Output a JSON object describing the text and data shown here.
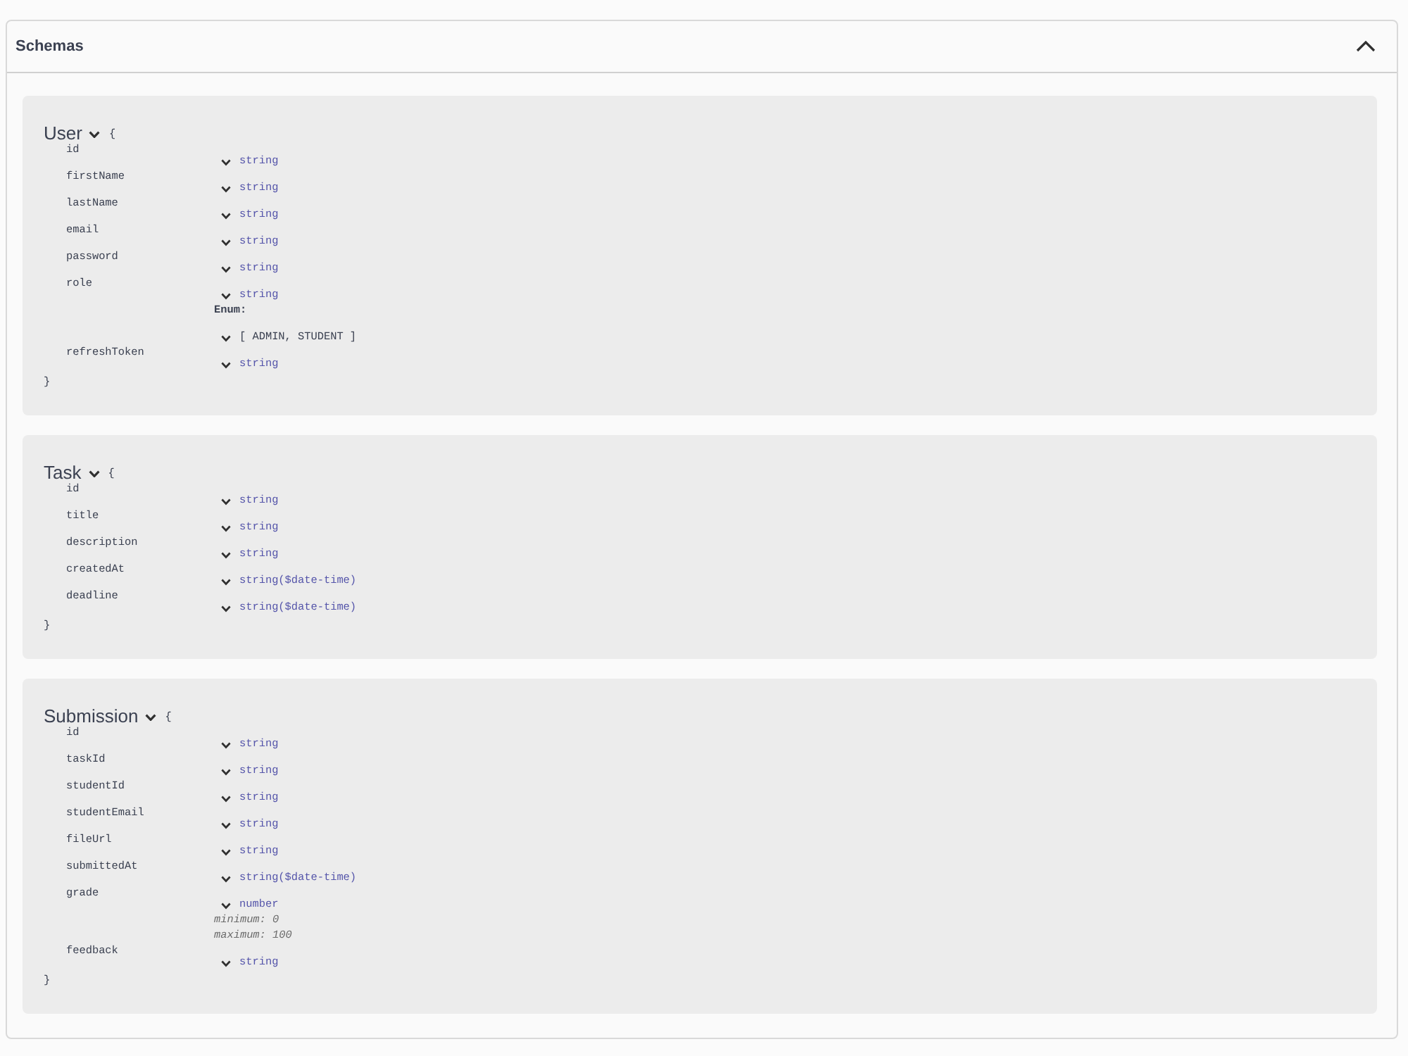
{
  "section": {
    "title": "Schemas",
    "expanded": true
  },
  "schemas": [
    {
      "name": "User",
      "expanded": true,
      "open_brace": "{",
      "close_brace": "}",
      "properties": [
        {
          "name": "id",
          "type": "string"
        },
        {
          "name": "firstName",
          "type": "string"
        },
        {
          "name": "lastName",
          "type": "string"
        },
        {
          "name": "email",
          "type": "string"
        },
        {
          "name": "password",
          "type": "string"
        },
        {
          "name": "role",
          "type": "string",
          "enum_label": "Enum:",
          "enum_values": "[ ADMIN, STUDENT ]"
        },
        {
          "name": "refreshToken",
          "type": "string"
        }
      ]
    },
    {
      "name": "Task",
      "expanded": true,
      "open_brace": "{",
      "close_brace": "}",
      "properties": [
        {
          "name": "id",
          "type": "string"
        },
        {
          "name": "title",
          "type": "string"
        },
        {
          "name": "description",
          "type": "string"
        },
        {
          "name": "createdAt",
          "type": "string($date-time)"
        },
        {
          "name": "deadline",
          "type": "string($date-time)"
        }
      ]
    },
    {
      "name": "Submission",
      "expanded": true,
      "open_brace": "{",
      "close_brace": "}",
      "properties": [
        {
          "name": "id",
          "type": "string"
        },
        {
          "name": "taskId",
          "type": "string"
        },
        {
          "name": "studentId",
          "type": "string"
        },
        {
          "name": "studentEmail",
          "type": "string"
        },
        {
          "name": "fileUrl",
          "type": "string"
        },
        {
          "name": "submittedAt",
          "type": "string($date-time)"
        },
        {
          "name": "grade",
          "type": "number",
          "constraints": [
            "minimum: 0",
            "maximum: 100"
          ]
        },
        {
          "name": "feedback",
          "type": "string"
        }
      ]
    }
  ]
}
